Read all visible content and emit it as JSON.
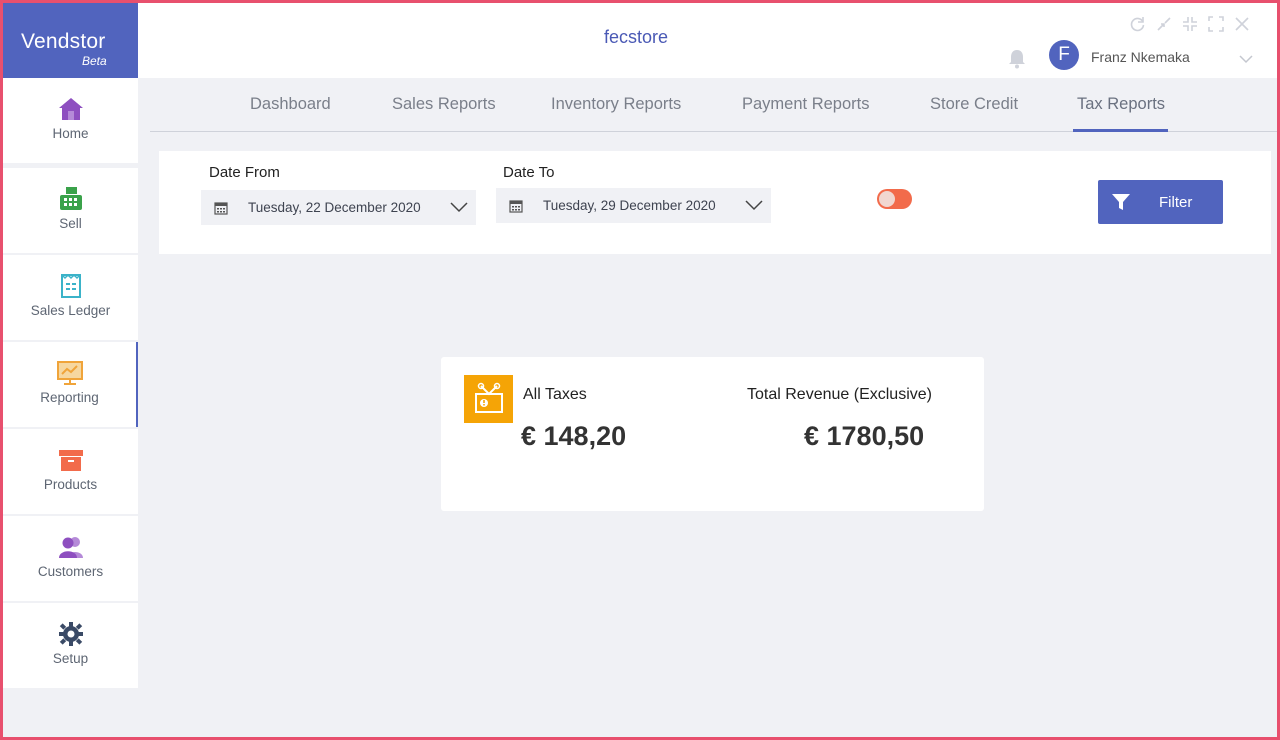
{
  "brand": {
    "name": "Vendstor",
    "sub": "Beta"
  },
  "header": {
    "store_title": "fecstore",
    "user": {
      "initial": "F",
      "name": "Franz Nkemaka"
    },
    "window_controls": [
      "refresh-icon",
      "minimize-icon",
      "restore-icon",
      "maximize-icon",
      "close-icon"
    ]
  },
  "sidebar": {
    "items": [
      {
        "label": "Home",
        "icon": "home-icon",
        "color": "#8e4fc0"
      },
      {
        "label": "Sell",
        "icon": "cash-register-icon",
        "color": "#3aa24a"
      },
      {
        "label": "Sales Ledger",
        "icon": "ledger-icon",
        "color": "#3bb3c9"
      },
      {
        "label": "Reporting",
        "icon": "reporting-icon",
        "color": "#f0a43a"
      },
      {
        "label": "Products",
        "icon": "products-box-icon",
        "color": "#f26b4b"
      },
      {
        "label": "Customers",
        "icon": "customers-icon",
        "color": "#8e4fc0"
      },
      {
        "label": "Setup",
        "icon": "gear-icon",
        "color": "#3a4a66"
      }
    ],
    "active": "Reporting"
  },
  "tabs": {
    "items": [
      "Dashboard",
      "Sales Reports",
      "Inventory Reports",
      "Payment Reports",
      "Store Credit",
      "Tax Reports"
    ],
    "active": "Tax Reports"
  },
  "filter": {
    "date_from_label": "Date From",
    "date_from_value": "Tuesday, 22 December 2020",
    "date_to_label": "Date To",
    "date_to_value": "Tuesday, 29 December 2020",
    "button_label": "Filter",
    "toggle_on": true
  },
  "tax_card": {
    "all_taxes_label": "All Taxes",
    "all_taxes_value": "€ 148,20",
    "revenue_label": "Total Revenue (Exclusive)",
    "revenue_value": "€ 1780,50"
  },
  "colors": {
    "accent": "#5164be",
    "frame_border": "#e8506e",
    "toggle": "#f26b4b",
    "tax_icon_bg": "#f5a406"
  }
}
